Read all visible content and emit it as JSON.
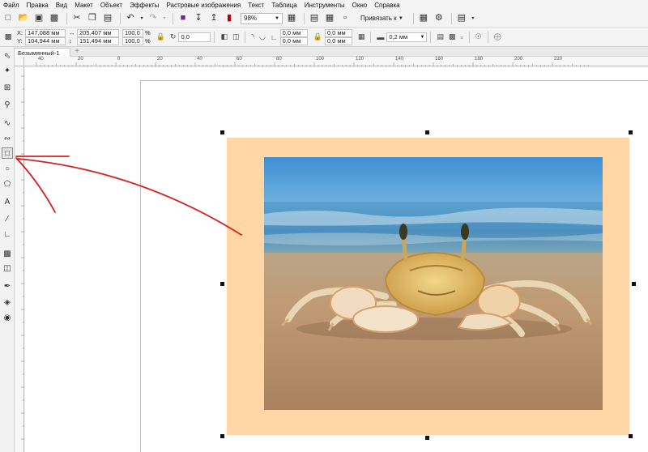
{
  "menu": {
    "items": [
      "Файл",
      "Правка",
      "Вид",
      "Макет",
      "Объект",
      "Эффекты",
      "Растровые изображения",
      "Текст",
      "Таблица",
      "Инструменты",
      "Окно",
      "Справка"
    ]
  },
  "toolbar": {
    "zoom_value": "98%",
    "snap_label": "Привязать к"
  },
  "property_bar": {
    "x_label": "X:",
    "x_value": "147,088 мм",
    "y_label": "Y:",
    "y_value": "104,944 мм",
    "width_value": "205,407 мм",
    "height_value": "151,494 мм",
    "scale_w": "100,0",
    "scale_h": "100,0",
    "percent": "%",
    "rotation": "0,0",
    "corner_1": "0,0 мм",
    "corner_2": "0,0 мм",
    "corner_3": "0,0 мм",
    "corner_4": "0,0 мм",
    "outline_width": "0,2 мм"
  },
  "document": {
    "tab_title": "Безымянный-1"
  },
  "ruler": {
    "top_labels": [
      "40",
      "20",
      "0",
      "20",
      "40",
      "60",
      "80",
      "100",
      "120",
      "140",
      "160",
      "180",
      "200",
      "220"
    ]
  },
  "colors": {
    "frame_fill": "#ffd7a6",
    "annotation": "#d42020"
  }
}
